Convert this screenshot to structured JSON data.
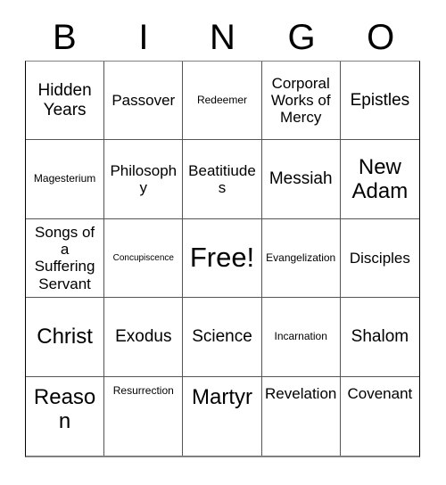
{
  "card": {
    "title": "Bingo Card",
    "header_letters": [
      "B",
      "I",
      "N",
      "G",
      "O"
    ],
    "free_space_label": "Free!",
    "colors": {
      "text": "#000000",
      "background": "#ffffff",
      "grid_line": "#555555",
      "frame_line": "#808080"
    },
    "grid": {
      "columns": 5,
      "rows": 5,
      "cells": [
        {
          "text": "Hidden Years",
          "size": "lg",
          "align": "middle"
        },
        {
          "text": "Passover",
          "size": "md",
          "align": "middle"
        },
        {
          "text": "Redeemer",
          "size": "sm",
          "align": "middle"
        },
        {
          "text": "Corporal Works of Mercy",
          "size": "md",
          "align": "middle"
        },
        {
          "text": "Epistles",
          "size": "lg",
          "align": "middle"
        },
        {
          "text": "Magesterium",
          "size": "sm",
          "align": "middle"
        },
        {
          "text": "Philosophy",
          "size": "md",
          "align": "middle"
        },
        {
          "text": "Beatitiudes",
          "size": "md",
          "align": "middle"
        },
        {
          "text": "Messiah",
          "size": "lg",
          "align": "middle"
        },
        {
          "text": "New Adam",
          "size": "xl",
          "align": "middle"
        },
        {
          "text": "Songs of a Suffering Servant",
          "size": "md",
          "align": "middle"
        },
        {
          "text": "Concupiscence",
          "size": "xs",
          "align": "middle"
        },
        {
          "text": "Free!",
          "size": "xxl",
          "align": "middle"
        },
        {
          "text": "Evangelization",
          "size": "sm",
          "align": "middle"
        },
        {
          "text": "Disciples",
          "size": "md",
          "align": "middle"
        },
        {
          "text": "Christ",
          "size": "xl",
          "align": "middle"
        },
        {
          "text": "Exodus",
          "size": "lg",
          "align": "middle"
        },
        {
          "text": "Science",
          "size": "lg",
          "align": "middle"
        },
        {
          "text": "Incarnation",
          "size": "sm",
          "align": "middle"
        },
        {
          "text": "Shalom",
          "size": "lg",
          "align": "middle"
        },
        {
          "text": "Reason",
          "size": "xl",
          "align": "top"
        },
        {
          "text": "Resurrection",
          "size": "sm",
          "align": "top"
        },
        {
          "text": "Martyr",
          "size": "xl",
          "align": "top"
        },
        {
          "text": "Revelation",
          "size": "md",
          "align": "top"
        },
        {
          "text": "Covenant",
          "size": "md",
          "align": "top"
        }
      ]
    }
  }
}
